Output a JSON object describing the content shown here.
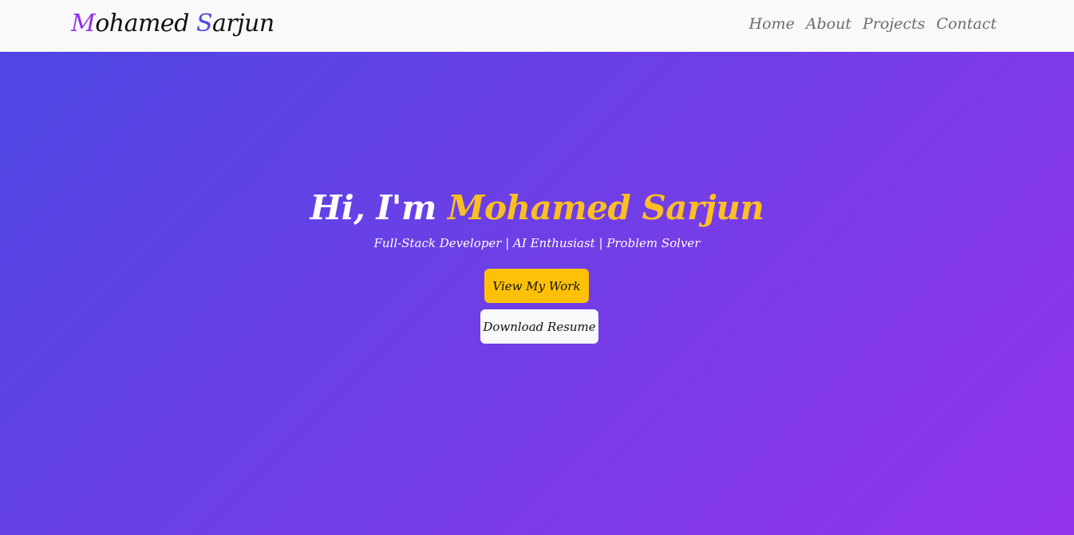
{
  "navbar": {
    "brand_initial_1": "M",
    "brand_rest_1": "ohamed ",
    "brand_initial_2": "S",
    "brand_rest_2": "arjun",
    "links": [
      {
        "label": "Home"
      },
      {
        "label": "About"
      },
      {
        "label": "Projects"
      },
      {
        "label": "Contact"
      }
    ]
  },
  "hero": {
    "greeting": "Hi, I'm ",
    "name": "Mohamed Sarjun",
    "subtitle": "Full-Stack Developer | AI Enthusiast | Problem Solver",
    "primary_button": "View My Work",
    "secondary_button": "Download Resume"
  },
  "colors": {
    "navbar_bg": "#f8f9fa",
    "gradient_start": "#4f46e5",
    "gradient_end": "#9333ea",
    "accent": "#fbbf24",
    "primary_button_bg": "#ffc107"
  }
}
